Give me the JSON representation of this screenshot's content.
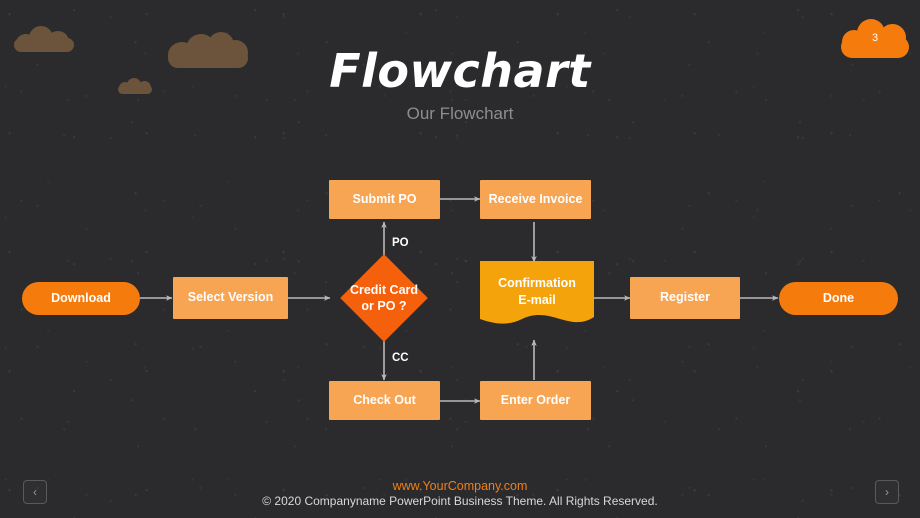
{
  "slide": {
    "title": "Flowchart",
    "subtitle": "Our Flowchart",
    "page_number": "3",
    "background_color": "#2b2b2d",
    "accent_color": "#ef7f1a"
  },
  "colors": {
    "light_orange": "#f7a453",
    "strong_orange": "#f57c0c",
    "deep_orange": "#f4600c",
    "amber": "#f5a30b",
    "cloud_brown": "#6b543b",
    "arrow_grey": "#b9b9b9"
  },
  "flowchart": {
    "nodes": [
      {
        "id": "download",
        "label": "Download",
        "shape": "pill",
        "color": "#f57c0c"
      },
      {
        "id": "select-version",
        "label": "Select Version",
        "shape": "rect",
        "color": "#f7a453"
      },
      {
        "id": "decision",
        "label": "Credit Card\nor PO ?",
        "shape": "diamond",
        "color": "#f4600c"
      },
      {
        "id": "submit-po",
        "label": "Submit PO",
        "shape": "rect",
        "color": "#f7a453"
      },
      {
        "id": "receive-invoice",
        "label": "Receive Invoice",
        "shape": "rect",
        "color": "#f7a453"
      },
      {
        "id": "check-out",
        "label": "Check Out",
        "shape": "rect",
        "color": "#f7a453"
      },
      {
        "id": "enter-order",
        "label": "Enter Order",
        "shape": "rect",
        "color": "#f7a453"
      },
      {
        "id": "confirmation",
        "label": "Confirmation\nE-mail",
        "shape": "document",
        "color": "#f5a30b"
      },
      {
        "id": "register",
        "label": "Register",
        "shape": "rect",
        "color": "#f7a453"
      },
      {
        "id": "done",
        "label": "Done",
        "shape": "pill",
        "color": "#f57c0c"
      }
    ],
    "node_labels": {
      "download": "Download",
      "select_version": "Select Version",
      "decision_line1": "Credit Card",
      "decision_line2": "or PO ?",
      "submit_po": "Submit PO",
      "receive_invoice": "Receive Invoice",
      "check_out": "Check Out",
      "enter_order": "Enter Order",
      "confirmation_line1": "Confirmation",
      "confirmation_line2": "E-mail",
      "register": "Register",
      "done": "Done"
    },
    "edge_labels": {
      "po": "PO",
      "cc": "CC"
    }
  },
  "footer": {
    "website": "www.YourCompany.com",
    "copyright": "© 2020 Companyname PowerPoint Business Theme. All Rights Reserved."
  },
  "nav": {
    "prev": "‹",
    "next": "›"
  }
}
